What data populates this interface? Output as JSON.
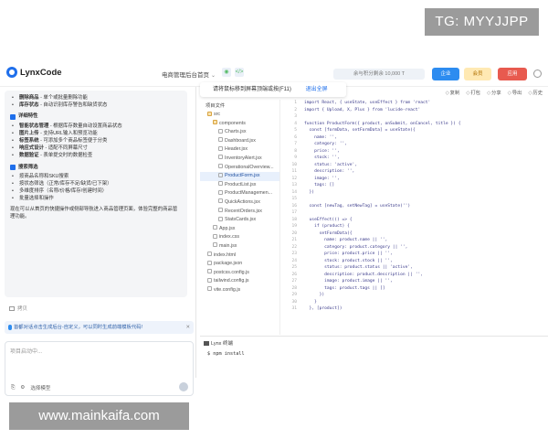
{
  "watermarks": {
    "top": "TG: MYYJJPP",
    "bottom": "www.mainkaifa.com"
  },
  "header": {
    "app_name": "LynxCode",
    "project": "电商管理后台首页",
    "credits": "余与积分剩余 10,000 T",
    "btn_enterprise": "企业",
    "btn_vip": "会员",
    "btn_app": "应用"
  },
  "chat": {
    "lines_top": [
      {
        "text": "删除商品 - 单个或批量删除功能",
        "bold": "删除商品"
      },
      {
        "text": "库存状态 - 自动识别库存警告和缺货状态",
        "bold": "库存状态"
      }
    ],
    "section1_title": "详细特性",
    "section1_items": [
      {
        "text": "智能状态管理 - 根据库存数量自动设置商品状态",
        "bold": "智能状态管理"
      },
      {
        "text": "图片上传 - 支持URL输入和预览功能",
        "bold": "图片上传"
      },
      {
        "text": "标签系统 - 可添加多个商品标签便于分类",
        "bold": "标签系统"
      },
      {
        "text": "响应式设计 - 适配不同屏幕尺寸",
        "bold": "响应式设计"
      },
      {
        "text": "数据验证 - 表单提交时的数据检查",
        "bold": "数据验证"
      }
    ],
    "section2_title": "搜索筛选",
    "section2_items": [
      {
        "text": "按商品名称和SKU搜索"
      },
      {
        "text": "按状态筛选（正常/库存不足/缺货/已下架）"
      },
      {
        "text": "多维度排序（名称/价格/库存/创建时间）"
      },
      {
        "text": "批量选择和操作"
      }
    ],
    "summary": "现在可以从首页的快捷操作或侧部导航进入商品管理页面，体验完整的商品管理功能。",
    "copy_label": "拷贝",
    "notice": "首都对话点击生成后台-自定义，可以同时生成前端模板代码!",
    "input_placeholder": "项目启动中...",
    "tool_hint": "选择模型"
  },
  "preview": {
    "tip": "请将鼠标移到屏幕顶端或按(F11)",
    "exit": "退出全屏"
  },
  "editor_actions": [
    "复制",
    "打包",
    "分享",
    "导出",
    "历史"
  ],
  "file_tree": {
    "header": "项目文件",
    "items": [
      {
        "name": "src",
        "indent": 1,
        "folder": true
      },
      {
        "name": "components",
        "indent": 2,
        "folder": true
      },
      {
        "name": "Charts.jsx",
        "indent": 3
      },
      {
        "name": "Dashboard.jsx",
        "indent": 3
      },
      {
        "name": "Header.jsx",
        "indent": 3
      },
      {
        "name": "InventoryAlert.jsx",
        "indent": 3
      },
      {
        "name": "OperationalOverview...",
        "indent": 3
      },
      {
        "name": "ProductForm.jsx",
        "indent": 3,
        "active": true
      },
      {
        "name": "ProductList.jsx",
        "indent": 3
      },
      {
        "name": "ProductManagemen...",
        "indent": 3
      },
      {
        "name": "QuickActions.jsx",
        "indent": 3
      },
      {
        "name": "RecentOrders.jsx",
        "indent": 3
      },
      {
        "name": "StatsCards.jsx",
        "indent": 3
      },
      {
        "name": "App.jsx",
        "indent": 2
      },
      {
        "name": "index.css",
        "indent": 2
      },
      {
        "name": "main.jsx",
        "indent": 2
      },
      {
        "name": "index.html",
        "indent": 1
      },
      {
        "name": "package.json",
        "indent": 1
      },
      {
        "name": "postcss.config.js",
        "indent": 1
      },
      {
        "name": "tailwind.config.js",
        "indent": 1
      },
      {
        "name": "vite.config.js",
        "indent": 1
      }
    ]
  },
  "code": [
    {
      "n": "1",
      "t": "import React, { useState, useEffect } from 'react'"
    },
    {
      "n": "2",
      "t": "import { Upload, X, Plus } from 'lucide-react'"
    },
    {
      "n": "3",
      "t": ""
    },
    {
      "n": "4",
      "t": "function ProductForm({ product, onSubmit, onCancel, title }) {"
    },
    {
      "n": "5",
      "t": "  const [formData, setFormData] = useState({"
    },
    {
      "n": "6",
      "t": "    name: '',"
    },
    {
      "n": "7",
      "t": "    category: '',"
    },
    {
      "n": "8",
      "t": "    price: '',"
    },
    {
      "n": "9",
      "t": "    stock: '',"
    },
    {
      "n": "10",
      "t": "    status: 'active',"
    },
    {
      "n": "11",
      "t": "    description: '',"
    },
    {
      "n": "12",
      "t": "    image: '',"
    },
    {
      "n": "13",
      "t": "    tags: []"
    },
    {
      "n": "14",
      "t": "  })"
    },
    {
      "n": "15",
      "t": ""
    },
    {
      "n": "16",
      "t": "  const [newTag, setNewTag] = useState('')"
    },
    {
      "n": "17",
      "t": ""
    },
    {
      "n": "18",
      "t": "  useEffect(() => {"
    },
    {
      "n": "19",
      "t": "    if (product) {"
    },
    {
      "n": "20",
      "t": "      setFormData({"
    },
    {
      "n": "21",
      "t": "        name: product.name || '',"
    },
    {
      "n": "22",
      "t": "        category: product.category || '',"
    },
    {
      "n": "23",
      "t": "        price: product.price || '',"
    },
    {
      "n": "24",
      "t": "        stock: product.stock || '',"
    },
    {
      "n": "25",
      "t": "        status: product.status || 'active',"
    },
    {
      "n": "26",
      "t": "        description: product.description || '',"
    },
    {
      "n": "27",
      "t": "        image: product.image || '',"
    },
    {
      "n": "28",
      "t": "        tags: product.tags || []"
    },
    {
      "n": "29",
      "t": "      })"
    },
    {
      "n": "30",
      "t": "    }"
    },
    {
      "n": "31",
      "t": "  }, [product])"
    }
  ],
  "terminal": {
    "tab": "Lynx 终端",
    "line": "$ npm install"
  }
}
